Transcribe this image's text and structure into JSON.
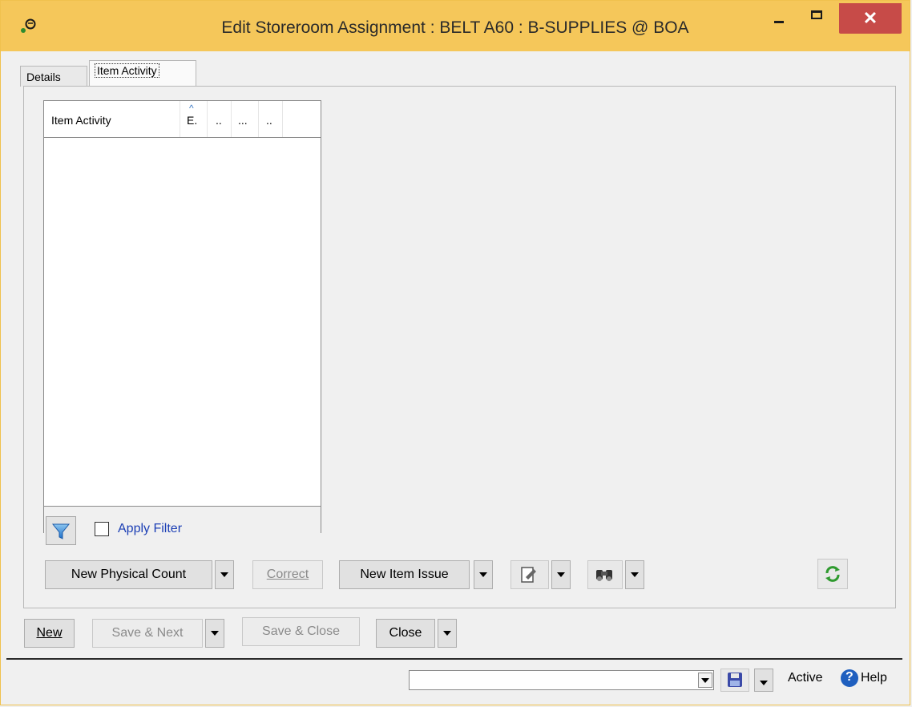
{
  "window": {
    "title": "Edit Storeroom Assignment : BELT A60 : B-SUPPLIES @ BOA",
    "close_glyph": "✕"
  },
  "tabs": [
    {
      "label": "Details",
      "selected": false
    },
    {
      "label": "Item Activity",
      "selected": true
    }
  ],
  "grid": {
    "columns": [
      "Item Activity",
      "E.",
      "..",
      "...",
      ".."
    ],
    "sort_indicator": "^",
    "rows": []
  },
  "filter": {
    "icon": "filter-icon",
    "apply_label": "Apply Filter",
    "checked": false
  },
  "toolbar": {
    "new_physical_count": "New Physical Count",
    "correct": "Correct",
    "new_item_issue": "New Item Issue",
    "edit_icon": "edit-icon",
    "find_icon": "binoculars-icon",
    "refresh_icon": "refresh-icon"
  },
  "footer": {
    "new": "New",
    "save_next": "Save & Next",
    "save_close": "Save & Close",
    "close": "Close"
  },
  "status": {
    "combo_value": "",
    "state": "Active",
    "help": "Help"
  },
  "colors": {
    "titlebar": "#f5c75a",
    "close_button": "#c74b48",
    "link_blue": "#1c3fb5"
  }
}
